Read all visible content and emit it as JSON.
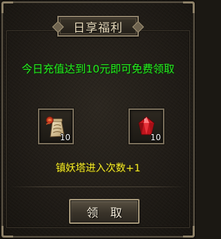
{
  "dialog": {
    "title": "日享福利",
    "headline": "今日充值达到10元即可免费领取",
    "reward_description": "镇妖塔进入次数+1",
    "claim_button_label": "领 取"
  },
  "rewards": [
    {
      "icon": "scroll-bag-icon",
      "count": "10"
    },
    {
      "icon": "red-gem-icon",
      "count": "10"
    }
  ],
  "colors": {
    "headline": "#29e521",
    "reward_text": "#f1e92a",
    "title_text": "#e9dcbd",
    "border": "#8f826a"
  }
}
